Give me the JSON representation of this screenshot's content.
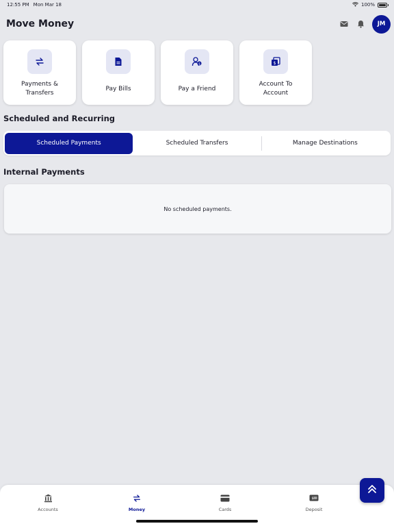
{
  "status_bar": {
    "time": "12:55 PM",
    "date": "Mon Mar 18",
    "battery": "100%"
  },
  "header": {
    "title": "Move Money",
    "avatar_initials": "JM",
    "icons": [
      "mail-icon",
      "bell-icon"
    ]
  },
  "quick_actions": [
    {
      "label": "Payments & Transfers",
      "icon": "transfer-arrows-icon"
    },
    {
      "label": "Pay Bills",
      "icon": "bill-document-icon"
    },
    {
      "label": "Pay a Friend",
      "icon": "pay-friend-icon"
    },
    {
      "label": "Account To Account",
      "icon": "account-transfer-icon"
    }
  ],
  "scheduled_section": {
    "title": "Scheduled and Recurring"
  },
  "tabs": [
    {
      "label": "Scheduled Payments",
      "active": true
    },
    {
      "label": "Scheduled Transfers",
      "active": false
    },
    {
      "label": "Manage Destinations",
      "active": false
    }
  ],
  "internal_payments": {
    "title": "Internal Payments",
    "empty_message": "No scheduled payments."
  },
  "bottom_nav": [
    {
      "label": "Accounts",
      "icon": "bank-icon",
      "active": false
    },
    {
      "label": "Money",
      "icon": "transfer-arrows-icon",
      "active": true
    },
    {
      "label": "Cards",
      "icon": "card-icon",
      "active": false
    },
    {
      "label": "Deposit",
      "icon": "check-deposit-icon",
      "active": false
    }
  ],
  "fab": {
    "icon": "double-chevron-up-icon"
  },
  "colors": {
    "accent": "#0d1896",
    "background": "#e7e8ec",
    "tile_icon_bg": "#e4e6f4"
  }
}
